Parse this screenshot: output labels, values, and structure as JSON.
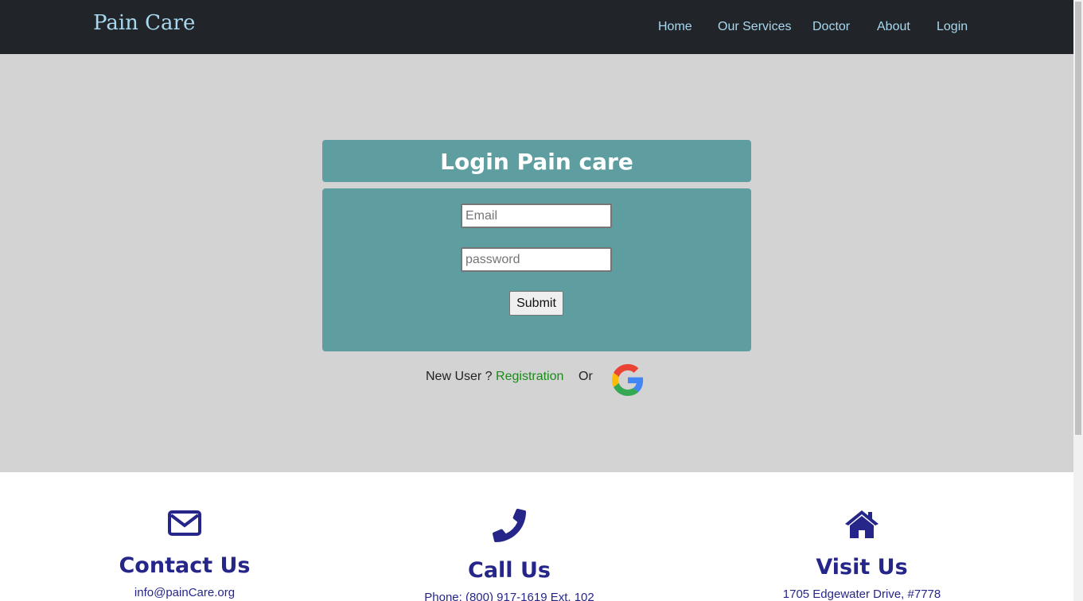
{
  "nav": {
    "brand": "Pain Care",
    "items": [
      "Home",
      "Our Services",
      "Doctor",
      "About",
      "Login"
    ]
  },
  "login": {
    "title": "Login Pain care",
    "email_placeholder": "Email",
    "password_placeholder": "password",
    "submit_label": "Submit",
    "new_user_text": "New User ?",
    "registration_label": "Registration",
    "or_text": "Or"
  },
  "contact": {
    "email": {
      "icon": "envelope-icon",
      "title": "Contact Us",
      "detail": "info@painCare.org"
    },
    "call": {
      "icon": "phone-icon",
      "title": "Call Us",
      "detail": "Phone: (800) 917-1619 Ext. 102"
    },
    "visit": {
      "icon": "home-icon",
      "title": "Visit Us",
      "detail": "1705 Edgewater Drive, #7778"
    }
  },
  "colors": {
    "navbar": "#212529",
    "brand_text": "#a8d8ef",
    "hero_bg": "#d3d3d3",
    "panel": "#5f9ea0",
    "link_green": "#1a8a1a",
    "contact_blue": "#26268a"
  }
}
